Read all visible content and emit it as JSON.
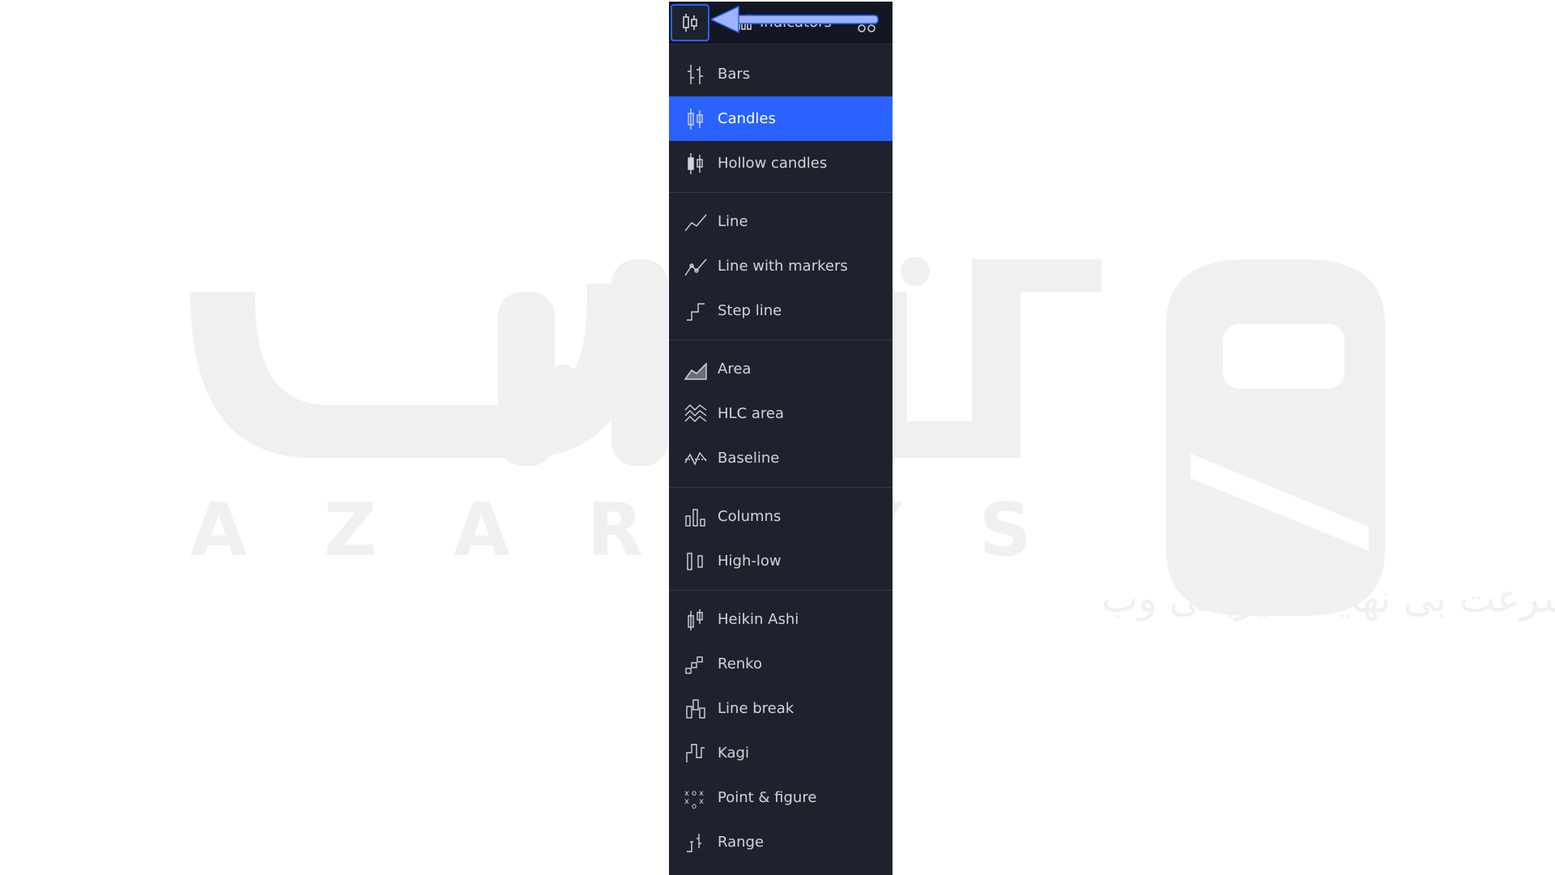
{
  "toolbar": {
    "indicators_label": "Indicators"
  },
  "watermark": {
    "brand": "AZARSYS",
    "brand_fa": "آذرسیس",
    "slogan_fa": "سرعت بی نهایت میزبانی وب"
  },
  "menu": {
    "groups": [
      [
        {
          "label": "Bars",
          "icon": "bars-icon",
          "selected": false
        },
        {
          "label": "Candles",
          "icon": "candles-icon",
          "selected": true
        },
        {
          "label": "Hollow candles",
          "icon": "hollow-candles-icon",
          "selected": false
        }
      ],
      [
        {
          "label": "Line",
          "icon": "line-icon",
          "selected": false
        },
        {
          "label": "Line with markers",
          "icon": "line-markers-icon",
          "selected": false
        },
        {
          "label": "Step line",
          "icon": "step-line-icon",
          "selected": false
        }
      ],
      [
        {
          "label": "Area",
          "icon": "area-icon",
          "selected": false
        },
        {
          "label": "HLC area",
          "icon": "hlc-area-icon",
          "selected": false
        },
        {
          "label": "Baseline",
          "icon": "baseline-icon",
          "selected": false
        }
      ],
      [
        {
          "label": "Columns",
          "icon": "columns-icon",
          "selected": false
        },
        {
          "label": "High-low",
          "icon": "high-low-icon",
          "selected": false
        }
      ],
      [
        {
          "label": "Heikin Ashi",
          "icon": "heikin-ashi-icon",
          "selected": false
        },
        {
          "label": "Renko",
          "icon": "renko-icon",
          "selected": false
        },
        {
          "label": "Line break",
          "icon": "line-break-icon",
          "selected": false
        },
        {
          "label": "Kagi",
          "icon": "kagi-icon",
          "selected": false
        },
        {
          "label": "Point & figure",
          "icon": "point-figure-icon",
          "selected": false
        },
        {
          "label": "Range",
          "icon": "range-icon",
          "selected": false
        }
      ]
    ]
  },
  "colors": {
    "panel_bg": "#1e222d",
    "accent": "#2962ff",
    "text": "#d1d4dc",
    "watermark": "#f0f0f0"
  }
}
